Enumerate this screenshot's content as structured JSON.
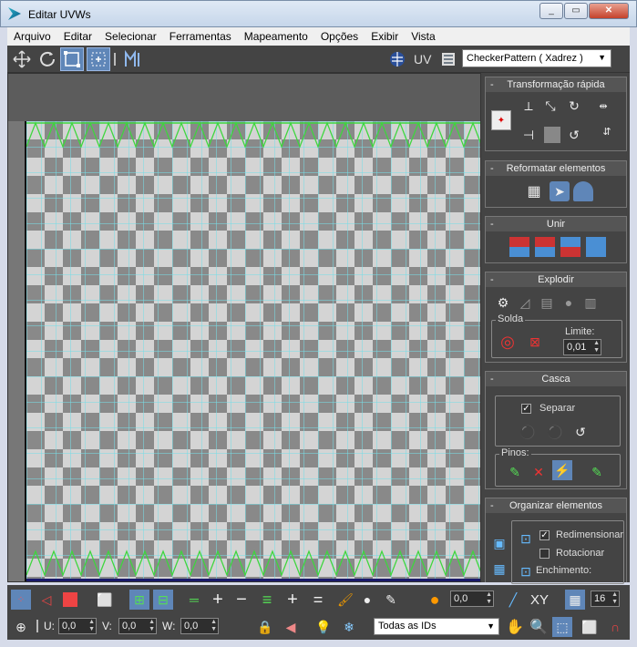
{
  "window": {
    "title": "Editar UVWs",
    "min": "_",
    "max": "▭",
    "close": "✕"
  },
  "menu": [
    "Arquivo",
    "Editar",
    "Selecionar",
    "Ferramentas",
    "Mapeamento",
    "Opções",
    "Exibir",
    "Vista"
  ],
  "toolbar": {
    "uv_label": "UV",
    "texture": "CheckerPattern  ( Xadrez )"
  },
  "rollouts": {
    "quick_transform": "Transformação rápida",
    "reshape": "Reformatar elementos",
    "stitch": "Unir",
    "explode": "Explodir",
    "weld_group": "Solda",
    "threshold_label": "Limite:",
    "threshold_value": "0,01",
    "peel": "Casca",
    "detach_label": "Separar",
    "pins_group": "Pinos:",
    "arrange": "Organizar elementos",
    "rescale_label": "Redimensionar",
    "rotate_label": "Rotacionar",
    "padding_label": "Enchimento:"
  },
  "bottom": {
    "soft_value": "0,0",
    "xy_label": "XY",
    "grid_value": "16",
    "u_label": "U:",
    "u_value": "0,0",
    "v_label": "V:",
    "v_value": "0,0",
    "w_label": "W:",
    "w_value": "0,0",
    "id_filter": "Todas as IDs"
  }
}
